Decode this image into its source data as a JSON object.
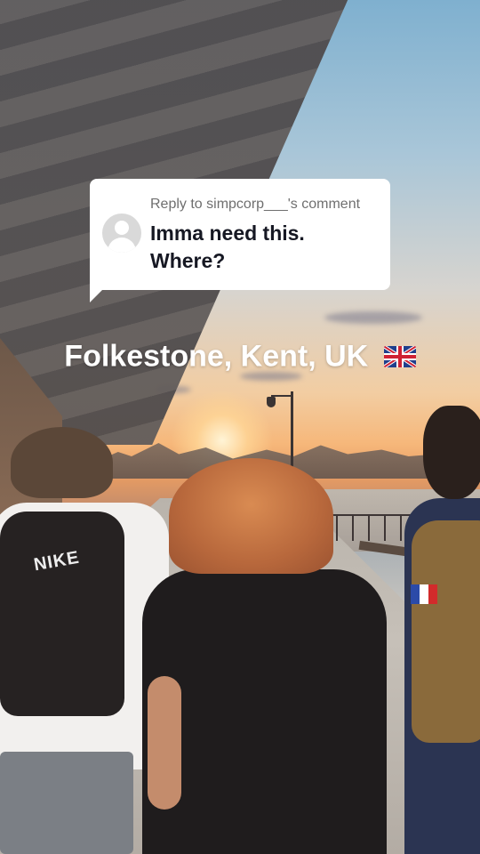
{
  "reply": {
    "to_label": "Reply to simpcorp___'s comment",
    "comment": "Imma need this. Where?",
    "avatar_icon": "default-avatar-icon"
  },
  "caption": {
    "text": "Folkestone, Kent, UK",
    "flag_icon": "uk-flag-icon"
  },
  "background_photo": {
    "shirt_logo": "NIKE"
  },
  "colors": {
    "card_bg": "#ffffff",
    "comment_text": "#161823",
    "reply_label": "#6f6f6f",
    "caption_text": "#ffffff"
  }
}
